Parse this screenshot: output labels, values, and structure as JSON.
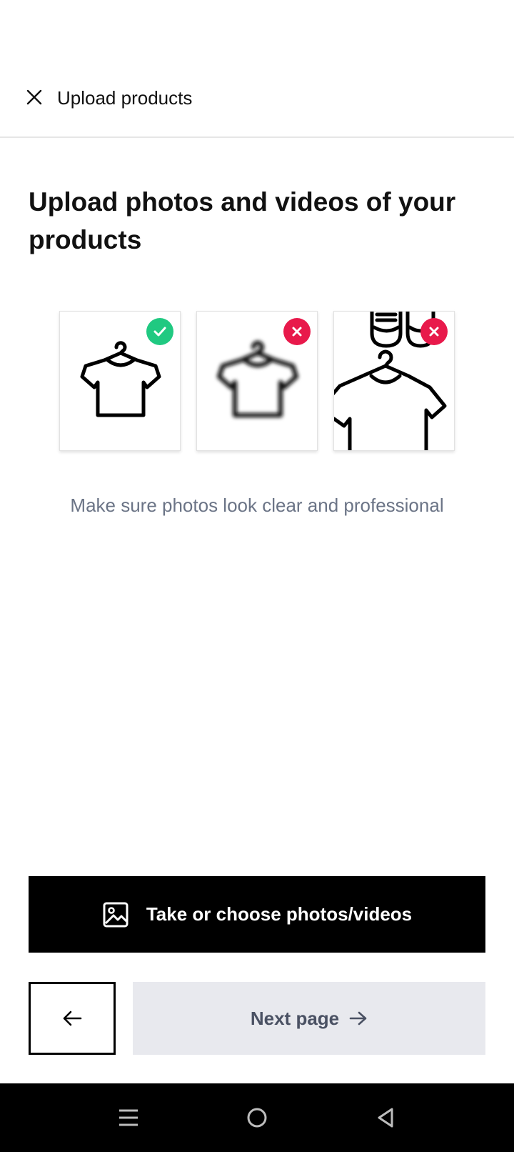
{
  "header": {
    "title": "Upload products",
    "close_icon": "close-icon"
  },
  "page": {
    "heading": "Upload photos and videos of your products",
    "hint": "Make sure photos look clear and professional"
  },
  "examples": [
    {
      "name": "clear-tshirt-example",
      "status": "good",
      "badge_icon": "check-icon"
    },
    {
      "name": "blurry-tshirt-example",
      "status": "bad",
      "badge_icon": "x-icon"
    },
    {
      "name": "cluttered-example",
      "status": "bad",
      "badge_icon": "x-icon"
    }
  ],
  "actions": {
    "primary_label": "Take or choose photos/videos",
    "primary_icon": "image-icon",
    "back_icon": "arrow-left-icon",
    "next_label": "Next page",
    "next_icon": "arrow-right-icon",
    "next_enabled": false
  },
  "system_nav": {
    "items": [
      "menu-icon",
      "home-icon",
      "back-triangle-icon"
    ]
  },
  "colors": {
    "good": "#20c981",
    "bad": "#e8194b",
    "primary_bg": "#000000",
    "disabled_bg": "#e8e9ee",
    "hint_text": "#6b7486"
  }
}
